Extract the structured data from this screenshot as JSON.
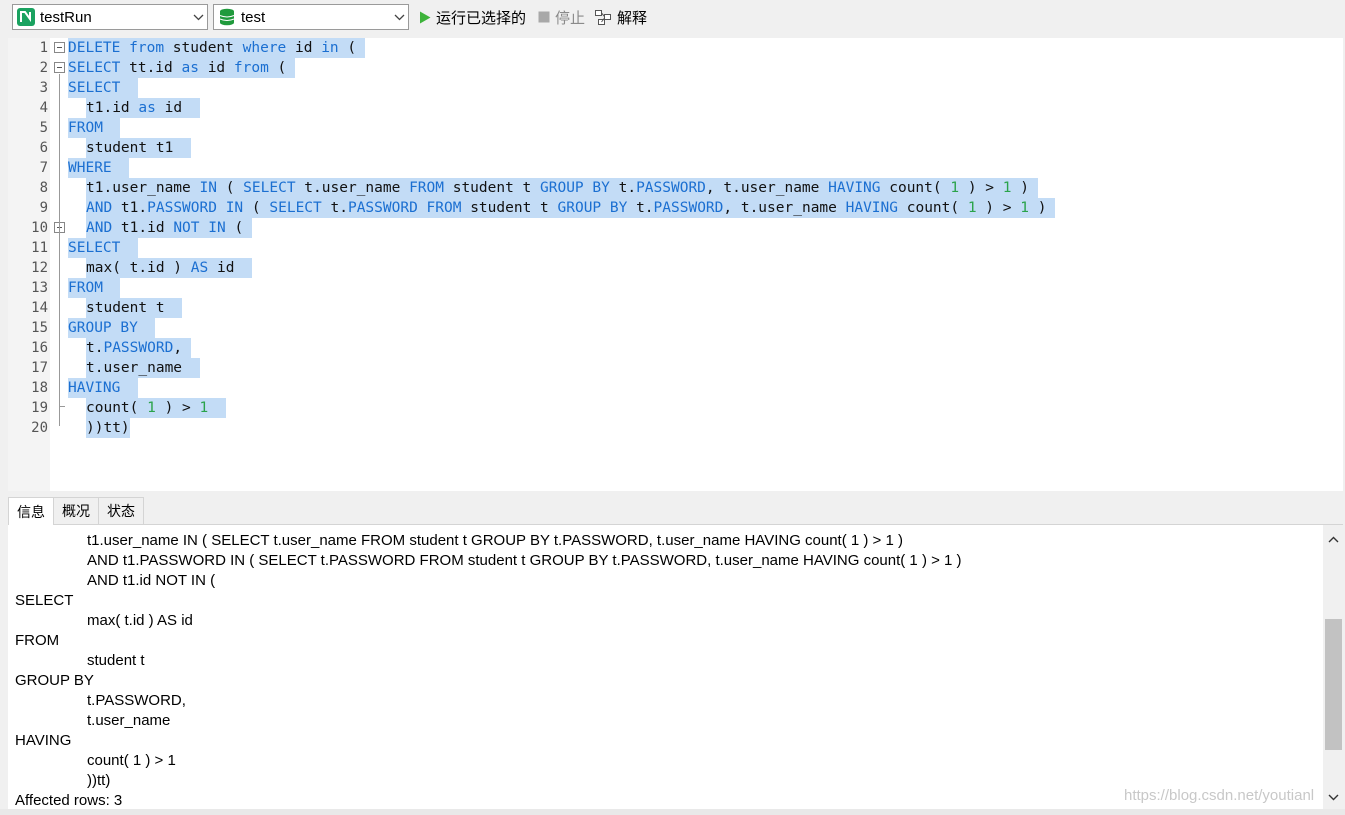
{
  "toolbar": {
    "connection": "testRun",
    "database": "test",
    "run_selected": "运行已选择的",
    "stop": "停止",
    "explain": "解释",
    "colors": {
      "run": "#3db33a",
      "connection_icon": "#1aa260",
      "db_icon": "#1f9a3c"
    }
  },
  "editor": {
    "lines": [
      {
        "n": "1",
        "fold": "start",
        "indent": false,
        "tokens": [
          {
            "t": "DELETE",
            "k": true
          },
          {
            "t": " "
          },
          {
            "t": "from",
            "k": true
          },
          {
            "t": " student "
          },
          {
            "t": "where",
            "k": true
          },
          {
            "t": " id "
          },
          {
            "t": "in",
            "k": true
          },
          {
            "t": " ( "
          }
        ]
      },
      {
        "n": "2",
        "fold": "start",
        "indent": false,
        "tokens": [
          {
            "t": "SELECT",
            "k": true
          },
          {
            "t": " tt.id "
          },
          {
            "t": "as",
            "k": true
          },
          {
            "t": " id "
          },
          {
            "t": "from",
            "k": true
          },
          {
            "t": " ( "
          }
        ]
      },
      {
        "n": "3",
        "fold": "",
        "indent": false,
        "tokens": [
          {
            "t": "SELECT",
            "k": true
          },
          {
            "t": "  "
          }
        ]
      },
      {
        "n": "4",
        "fold": "",
        "indent": true,
        "tokens": [
          {
            "t": "t1.id "
          },
          {
            "t": "as",
            "k": true
          },
          {
            "t": " id  "
          }
        ]
      },
      {
        "n": "5",
        "fold": "",
        "indent": false,
        "tokens": [
          {
            "t": "FROM",
            "k": true
          },
          {
            "t": "  "
          }
        ]
      },
      {
        "n": "6",
        "fold": "",
        "indent": true,
        "tokens": [
          {
            "t": "student t1  "
          }
        ]
      },
      {
        "n": "7",
        "fold": "",
        "indent": false,
        "tokens": [
          {
            "t": "WHERE",
            "k": true
          },
          {
            "t": "  "
          }
        ]
      },
      {
        "n": "8",
        "fold": "",
        "indent": true,
        "tokens": [
          {
            "t": "t1.user_name "
          },
          {
            "t": "IN",
            "k": true
          },
          {
            "t": " ( "
          },
          {
            "t": "SELECT",
            "k": true
          },
          {
            "t": " t.user_name "
          },
          {
            "t": "FROM",
            "k": true
          },
          {
            "t": " student t "
          },
          {
            "t": "GROUP BY",
            "k": true
          },
          {
            "t": " t."
          },
          {
            "t": "PASSWORD",
            "k": true
          },
          {
            "t": ", t.user_name "
          },
          {
            "t": "HAVING",
            "k": true
          },
          {
            "t": " count( "
          },
          {
            "t": "1",
            "num": true
          },
          {
            "t": " ) > "
          },
          {
            "t": "1",
            "num": true
          },
          {
            "t": " ) "
          }
        ]
      },
      {
        "n": "9",
        "fold": "",
        "indent": true,
        "tokens": [
          {
            "t": "AND",
            "k": true
          },
          {
            "t": " t1."
          },
          {
            "t": "PASSWORD",
            "k": true
          },
          {
            "t": " "
          },
          {
            "t": "IN",
            "k": true
          },
          {
            "t": " ( "
          },
          {
            "t": "SELECT",
            "k": true
          },
          {
            "t": " t."
          },
          {
            "t": "PASSWORD",
            "k": true
          },
          {
            "t": " "
          },
          {
            "t": "FROM",
            "k": true
          },
          {
            "t": " student t "
          },
          {
            "t": "GROUP BY",
            "k": true
          },
          {
            "t": " t."
          },
          {
            "t": "PASSWORD",
            "k": true
          },
          {
            "t": ", t.user_name "
          },
          {
            "t": "HAVING",
            "k": true
          },
          {
            "t": " count( "
          },
          {
            "t": "1",
            "num": true
          },
          {
            "t": " ) > "
          },
          {
            "t": "1",
            "num": true
          },
          {
            "t": " ) "
          }
        ]
      },
      {
        "n": "10",
        "fold": "start",
        "indent": true,
        "tokens": [
          {
            "t": "AND",
            "k": true
          },
          {
            "t": " t1.id "
          },
          {
            "t": "NOT",
            "k": true
          },
          {
            "t": " "
          },
          {
            "t": "IN",
            "k": true
          },
          {
            "t": " ( "
          }
        ]
      },
      {
        "n": "11",
        "fold": "",
        "indent": false,
        "tokens": [
          {
            "t": "SELECT",
            "k": true
          },
          {
            "t": "  "
          }
        ]
      },
      {
        "n": "12",
        "fold": "",
        "indent": true,
        "tokens": [
          {
            "t": "max( t.id ) "
          },
          {
            "t": "AS",
            "k": true
          },
          {
            "t": " id  "
          }
        ]
      },
      {
        "n": "13",
        "fold": "",
        "indent": false,
        "tokens": [
          {
            "t": "FROM",
            "k": true
          },
          {
            "t": "  "
          }
        ]
      },
      {
        "n": "14",
        "fold": "",
        "indent": true,
        "tokens": [
          {
            "t": "student t  "
          }
        ]
      },
      {
        "n": "15",
        "fold": "",
        "indent": false,
        "tokens": [
          {
            "t": "GROUP BY",
            "k": true
          },
          {
            "t": "  "
          }
        ]
      },
      {
        "n": "16",
        "fold": "",
        "indent": true,
        "tokens": [
          {
            "t": "t."
          },
          {
            "t": "PASSWORD",
            "k": true
          },
          {
            "t": ", "
          }
        ]
      },
      {
        "n": "17",
        "fold": "",
        "indent": true,
        "tokens": [
          {
            "t": "t.user_name  "
          }
        ]
      },
      {
        "n": "18",
        "fold": "",
        "indent": false,
        "tokens": [
          {
            "t": "HAVING",
            "k": true
          },
          {
            "t": "  "
          }
        ]
      },
      {
        "n": "19",
        "fold": "end",
        "indent": true,
        "tokens": [
          {
            "t": "count( "
          },
          {
            "t": "1",
            "num": true
          },
          {
            "t": " ) > "
          },
          {
            "t": "1",
            "num": true
          },
          {
            "t": "  "
          }
        ]
      },
      {
        "n": "20",
        "fold": "",
        "indent": true,
        "tokens": [
          {
            "t": "))tt)"
          }
        ]
      }
    ]
  },
  "tabs": [
    "信息",
    "概况",
    "状态"
  ],
  "results": {
    "lines": [
      {
        "indent": true,
        "text": "t1.user_name IN ( SELECT t.user_name FROM student t GROUP BY t.PASSWORD, t.user_name HAVING count( 1 ) > 1 )"
      },
      {
        "indent": true,
        "text": "AND t1.PASSWORD IN ( SELECT t.PASSWORD FROM student t GROUP BY t.PASSWORD, t.user_name HAVING count( 1 ) > 1 )"
      },
      {
        "indent": true,
        "text": "AND t1.id NOT IN ("
      },
      {
        "indent": false,
        "text": "SELECT"
      },
      {
        "indent": true,
        "text": "max( t.id ) AS id"
      },
      {
        "indent": false,
        "text": "FROM"
      },
      {
        "indent": true,
        "text": "student t"
      },
      {
        "indent": false,
        "text": "GROUP BY"
      },
      {
        "indent": true,
        "text": "t.PASSWORD,"
      },
      {
        "indent": true,
        "text": "t.user_name"
      },
      {
        "indent": false,
        "text": "HAVING"
      },
      {
        "indent": true,
        "text": "count( 1 ) > 1"
      },
      {
        "indent": true,
        "text": "))tt)"
      },
      {
        "indent": false,
        "text": "Affected rows: 3"
      }
    ]
  },
  "watermark": "https://blog.csdn.net/youtianl"
}
